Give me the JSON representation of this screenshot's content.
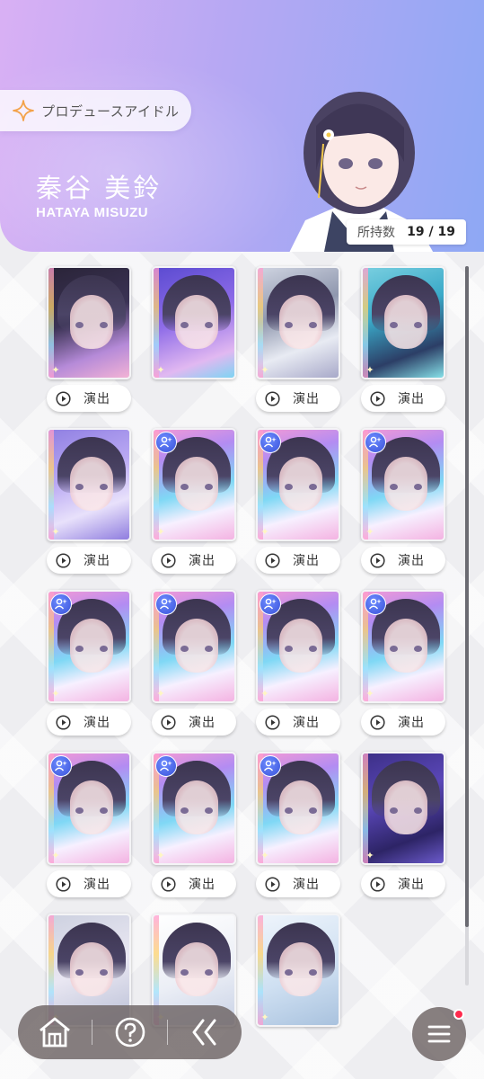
{
  "header": {
    "produce_label": "プロデュースアイドル",
    "name_jp": "秦谷 美鈴",
    "name_en": "HATAYA MISUZU",
    "owned_label": "所持数",
    "owned_value": "19 / 19"
  },
  "cards": [
    {
      "variant": "dark",
      "has_badge": false,
      "button": "演出"
    },
    {
      "variant": "violet",
      "has_badge": false,
      "button": ""
    },
    {
      "variant": "silver",
      "has_badge": false,
      "button": "演出"
    },
    {
      "variant": "teal",
      "has_badge": false,
      "button": "演出"
    },
    {
      "variant": "lavender",
      "has_badge": false,
      "button": "演出"
    },
    {
      "variant": "prism",
      "has_badge": true,
      "button": "演出"
    },
    {
      "variant": "prism",
      "has_badge": true,
      "button": "演出"
    },
    {
      "variant": "prism",
      "has_badge": true,
      "button": "演出"
    },
    {
      "variant": "prism",
      "has_badge": true,
      "button": "演出"
    },
    {
      "variant": "prism",
      "has_badge": true,
      "button": "演出"
    },
    {
      "variant": "prism",
      "has_badge": true,
      "button": "演出"
    },
    {
      "variant": "prism",
      "has_badge": true,
      "button": "演出"
    },
    {
      "variant": "prism",
      "has_badge": true,
      "button": "演出"
    },
    {
      "variant": "prism",
      "has_badge": true,
      "button": "演出"
    },
    {
      "variant": "prism",
      "has_badge": true,
      "button": "演出"
    },
    {
      "variant": "navy",
      "has_badge": false,
      "button": "演出"
    },
    {
      "variant": "pale",
      "has_badge": false,
      "button": ""
    },
    {
      "variant": "white",
      "has_badge": false,
      "button": ""
    },
    {
      "variant": "sky",
      "has_badge": false,
      "button": ""
    }
  ],
  "nav": {
    "items": [
      "home-icon",
      "help-icon",
      "back-icon"
    ],
    "menu_icon": "menu-icon"
  },
  "colors": {
    "header_start": "#d9b0f4",
    "header_end": "#8ea8f4",
    "badge_blue": "#3a52d9",
    "notify": "#ff2a4d"
  }
}
